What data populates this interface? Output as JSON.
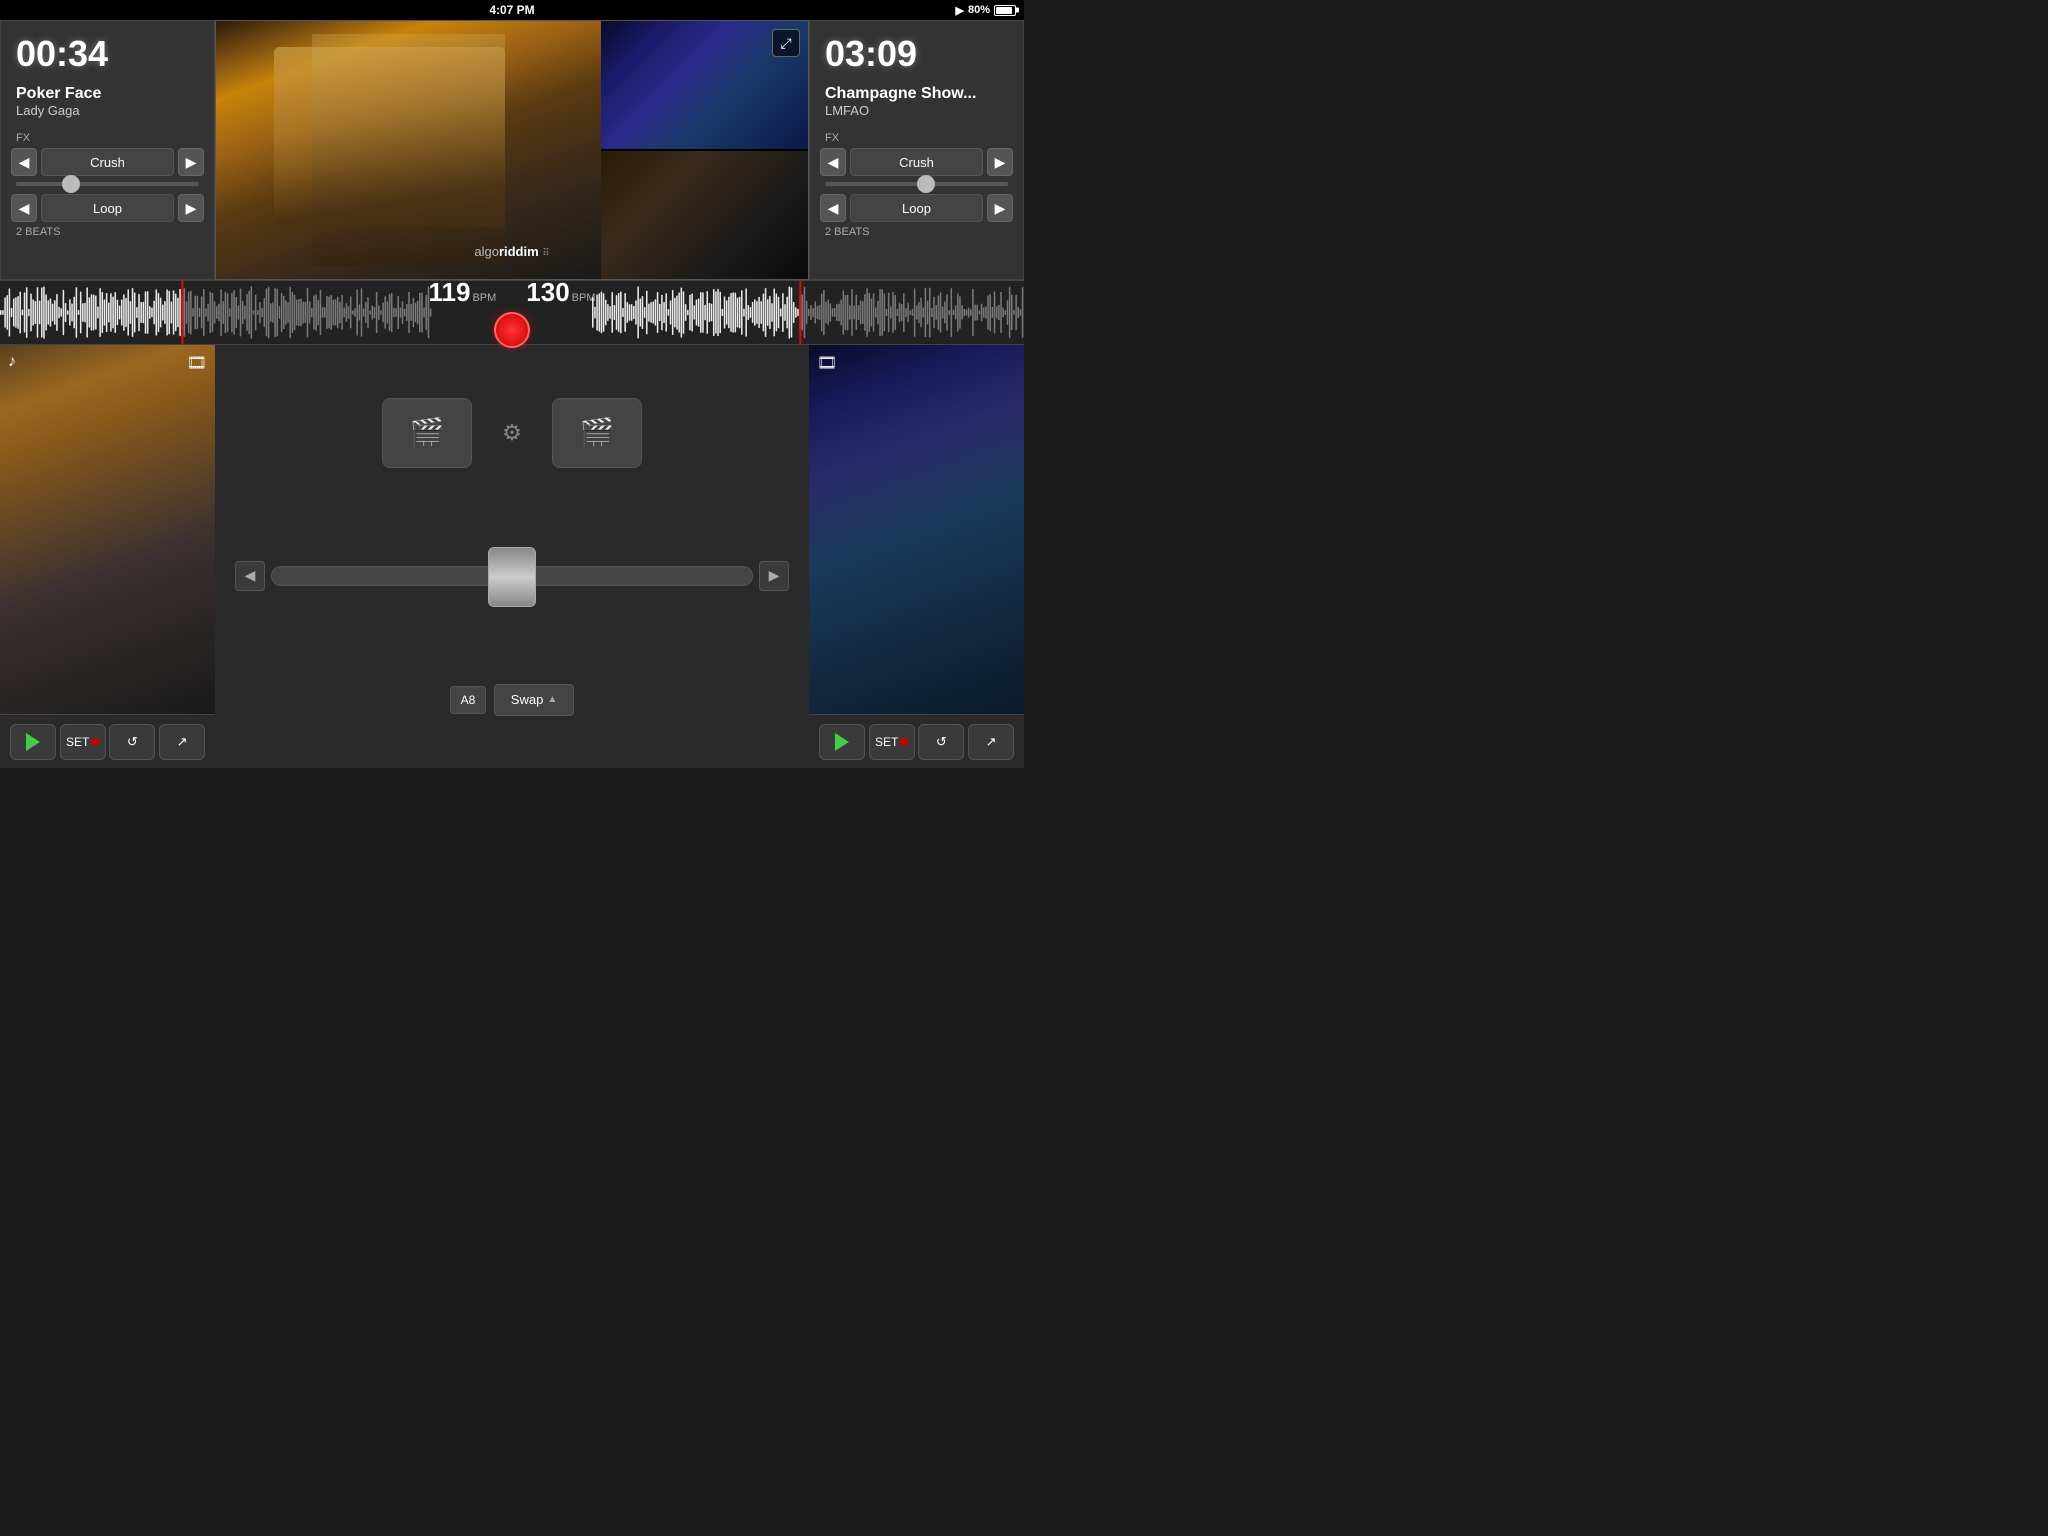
{
  "statusBar": {
    "time": "4:07 PM",
    "battery": "80%",
    "playing": true
  },
  "deckLeft": {
    "timer": "00:34",
    "trackTitle": "Poker Face",
    "artist": "Lady Gaga",
    "fxLabel": "FX",
    "fxName": "Crush",
    "loopName": "Loop",
    "loopBeats": "2 BEATS",
    "prevFxLabel": "◀",
    "nextFxLabel": "▶",
    "prevLoopLabel": "◀",
    "nextLoopLabel": "▶"
  },
  "deckRight": {
    "timer": "03:09",
    "trackTitle": "Champagne Show...",
    "artist": "LMFAO",
    "fxLabel": "FX",
    "fxName": "Crush",
    "loopName": "Loop",
    "loopBeats": "2 BEATS",
    "prevFxLabel": "◀",
    "nextFxLabel": "▶",
    "prevLoopLabel": "◀",
    "nextLoopLabel": "▶"
  },
  "waveform": {
    "leftBpm": "119",
    "rightBpm": "130",
    "bpmUnit": "BPM"
  },
  "logo": {
    "text1": "algo",
    "text2": "riddim",
    "gridIcon": "⋮⋮⋮"
  },
  "bottomControls": {
    "setLabel": "SET",
    "swapLabel": "Swap",
    "abLabel": "A8"
  },
  "colors": {
    "accent": "#44cc44",
    "record": "#cc0000",
    "playhead": "#ff0000",
    "waveform": "rgba(255,255,255,0.75)"
  }
}
